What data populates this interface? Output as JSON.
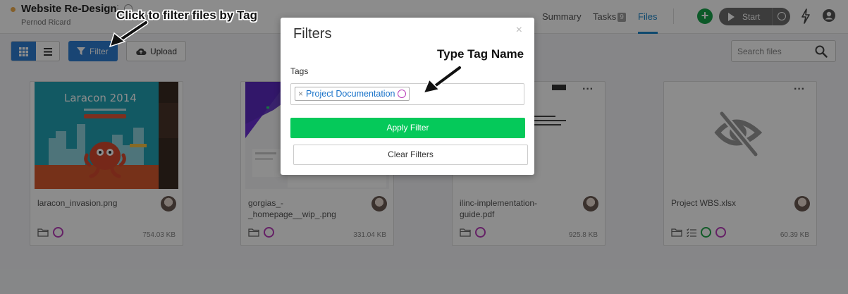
{
  "header": {
    "project_title": "Website Re-Design",
    "project_client": "Pernod Ricard",
    "tabs": [
      {
        "label": "Summary"
      },
      {
        "label": "Tasks",
        "badge": "9"
      },
      {
        "label": "Files",
        "active": true
      }
    ],
    "start_label": "Start",
    "icons": [
      "add-icon",
      "play-icon",
      "timer-icon",
      "bolt-icon",
      "user-icon"
    ]
  },
  "toolbar": {
    "filter_label": "Filter",
    "upload_label": "Upload",
    "search_placeholder": "Search files"
  },
  "files": [
    {
      "name": "laracon_invasion.png",
      "size": "754.03 KB",
      "tags": [
        "purple"
      ],
      "thumb_text": "Laracon 2014"
    },
    {
      "name": "gorgias_-_homepage__wip_.png",
      "name_display": "gorgias_-\n_homepage__wip_.png",
      "size": "331.04 KB",
      "tags": [
        "purple"
      ]
    },
    {
      "name": "ilinc-implementation-guide.pdf",
      "name_display": "ilinc-implementation-\nguide.pdf",
      "size": "925.8 KB",
      "tags": [
        "purple"
      ]
    },
    {
      "name": "Project WBS.xlsx",
      "size": "60.39 KB",
      "tags": [
        "green",
        "purple"
      ]
    }
  ],
  "modal": {
    "title": "Filters",
    "close": "×",
    "tags_label": "Tags",
    "selected_tag": "Project Documentation",
    "chip_remove": "×",
    "apply_label": "Apply Filter",
    "clear_label": "Clear Filters"
  },
  "annotations": {
    "filter_hint": "Click to filter files by Tag",
    "tag_hint": "Type Tag Name"
  },
  "colors": {
    "primary": "#2e7fd4",
    "apply_green": "#05c95a",
    "tag_purple": "#b83dba",
    "tag_green": "#22a64a",
    "active_tab": "#1b85c9"
  }
}
